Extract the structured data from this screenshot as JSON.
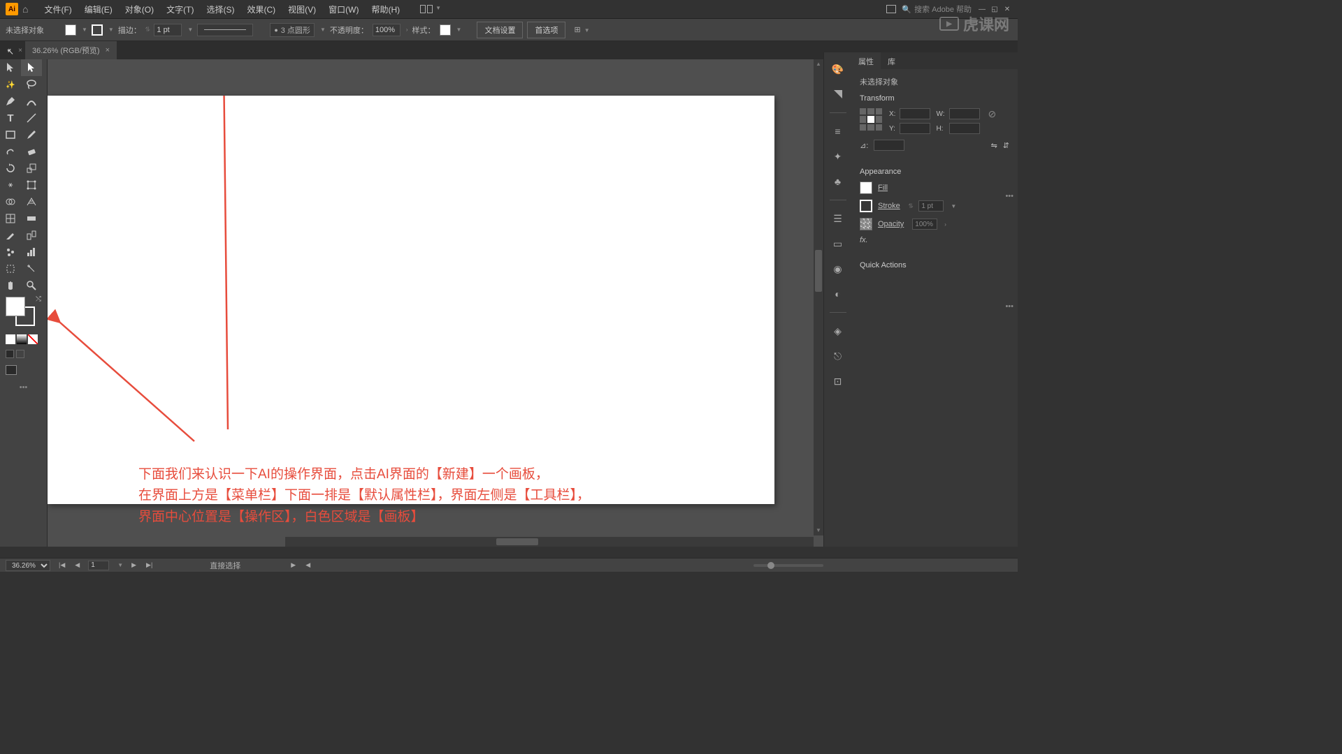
{
  "menubar": {
    "items": [
      "文件(F)",
      "编辑(E)",
      "对象(O)",
      "文字(T)",
      "选择(S)",
      "效果(C)",
      "视图(V)",
      "窗口(W)",
      "帮助(H)"
    ],
    "search_placeholder": "搜索 Adobe 帮助"
  },
  "optbar": {
    "no_selection": "未选择对象",
    "stroke_label": "描边：",
    "stroke_value": "1 pt",
    "shape_label": "3 点圆形",
    "opacity_label": "不透明度：",
    "opacity_value": "100%",
    "style_label": "样式：",
    "doc_setup": "文档设置",
    "preferences": "首选项"
  },
  "tab": {
    "title": "36.26% (RGB/预览)"
  },
  "canvas": {
    "annotation_line1": "下面我们来认识一下AI的操作界面，点击AI界面的【新建】一个画板，",
    "annotation_line2": "在界面上方是【菜单栏】下面一排是【默认属性栏】，界面左侧是【工具栏】，",
    "annotation_line3": "界面中心位置是【操作区】，白色区域是【画板】"
  },
  "statusbar": {
    "zoom": "36.26%",
    "artboard": "1",
    "tool_hint": "直接选择"
  },
  "props": {
    "tab_properties": "属性",
    "tab_library": "库",
    "no_selection": "未选择对象",
    "transform_title": "Transform",
    "x_label": "X:",
    "y_label": "Y:",
    "w_label": "W:",
    "h_label": "H:",
    "angle_label": "⊿:",
    "appearance_title": "Appearance",
    "fill_label": "Fill",
    "stroke_label": "Stroke",
    "stroke_value": "1 pt",
    "opacity_label": "Opacity",
    "opacity_value": "100%",
    "fx_label": "fx.",
    "quick_actions": "Quick Actions"
  },
  "watermark": "虎课网"
}
